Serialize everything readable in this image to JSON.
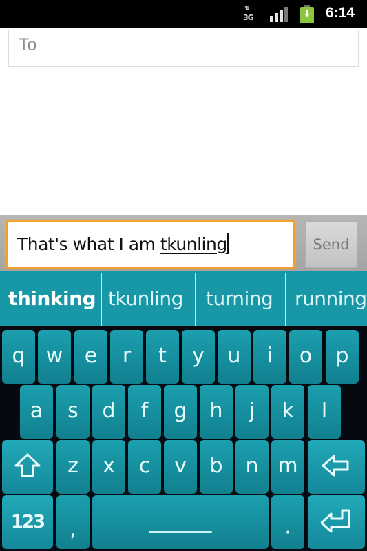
{
  "status_bar": {
    "network_label": "3G",
    "signal_icon": "signal-bars-icon",
    "battery_icon": "battery-charging-icon",
    "time": "6:14"
  },
  "compose": {
    "to_placeholder": "To",
    "message_prefix": "That's what I am ",
    "message_composing": "tkunling",
    "send_label": "Send"
  },
  "suggestions": [
    {
      "label": "thinking",
      "bold": true
    },
    {
      "label": "tkunling",
      "bold": false
    },
    {
      "label": "turning",
      "bold": false
    },
    {
      "label": "running",
      "bold": false
    }
  ],
  "keyboard": {
    "row1": [
      "q",
      "w",
      "e",
      "r",
      "t",
      "y",
      "u",
      "i",
      "o",
      "p"
    ],
    "row2": [
      "a",
      "s",
      "d",
      "f",
      "g",
      "h",
      "j",
      "k",
      "l"
    ],
    "row3": [
      "z",
      "x",
      "c",
      "v",
      "b",
      "n",
      "m"
    ],
    "shift_icon": "shift-arrow-icon",
    "delete_icon": "backspace-arrow-icon",
    "symbols_label": "123",
    "comma_label": ",",
    "period_label": ".",
    "enter_icon": "enter-return-icon",
    "accent_color": "#1897a6"
  }
}
